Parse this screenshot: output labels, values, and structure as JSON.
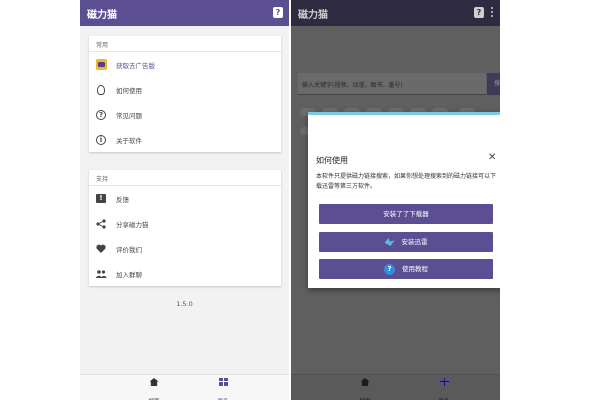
{
  "left_screen": {
    "app_title": "磁力猫",
    "help_icon_glyph": "?",
    "sections": [
      {
        "title": "常用",
        "items": [
          {
            "label": "获取去广告版",
            "icon": "crown-icon"
          },
          {
            "label": "如何使用",
            "icon": "lightbulb-icon"
          },
          {
            "label": "常见问题",
            "icon": "help-circle-icon"
          },
          {
            "label": "关于软件",
            "icon": "info-icon"
          }
        ]
      },
      {
        "title": "支持",
        "items": [
          {
            "label": "反馈",
            "icon": "feedback-icon"
          },
          {
            "label": "分享磁力猫",
            "icon": "share-icon"
          },
          {
            "label": "评价我们",
            "icon": "heart-icon"
          },
          {
            "label": "加入群聊",
            "icon": "group-icon"
          }
        ]
      }
    ],
    "version": "1.5.0",
    "nav": {
      "search": "搜索",
      "more": "更多"
    }
  },
  "right_screen": {
    "app_title": "磁力猫",
    "help_icon_glyph": "?",
    "search_placeholder": "输入关键字(视频，动漫，图书，番号)",
    "search_button": "搜索",
    "dialog": {
      "title": "如何使用",
      "close_glyph": "✕",
      "body": "本软件只提供磁力链接搜索，如果你想处理搜索到的磁力链接可以下载迅雷等第三方软件。",
      "buttons": [
        "安装了了下载器",
        "安装迅雷",
        "使用教程"
      ]
    },
    "nav": {
      "search": "搜索",
      "more": "更多"
    }
  },
  "colors": {
    "primary": "#5b4e92",
    "overlay_bg": "#5f5f5f",
    "dialog_accent": "#7ec8e3"
  }
}
